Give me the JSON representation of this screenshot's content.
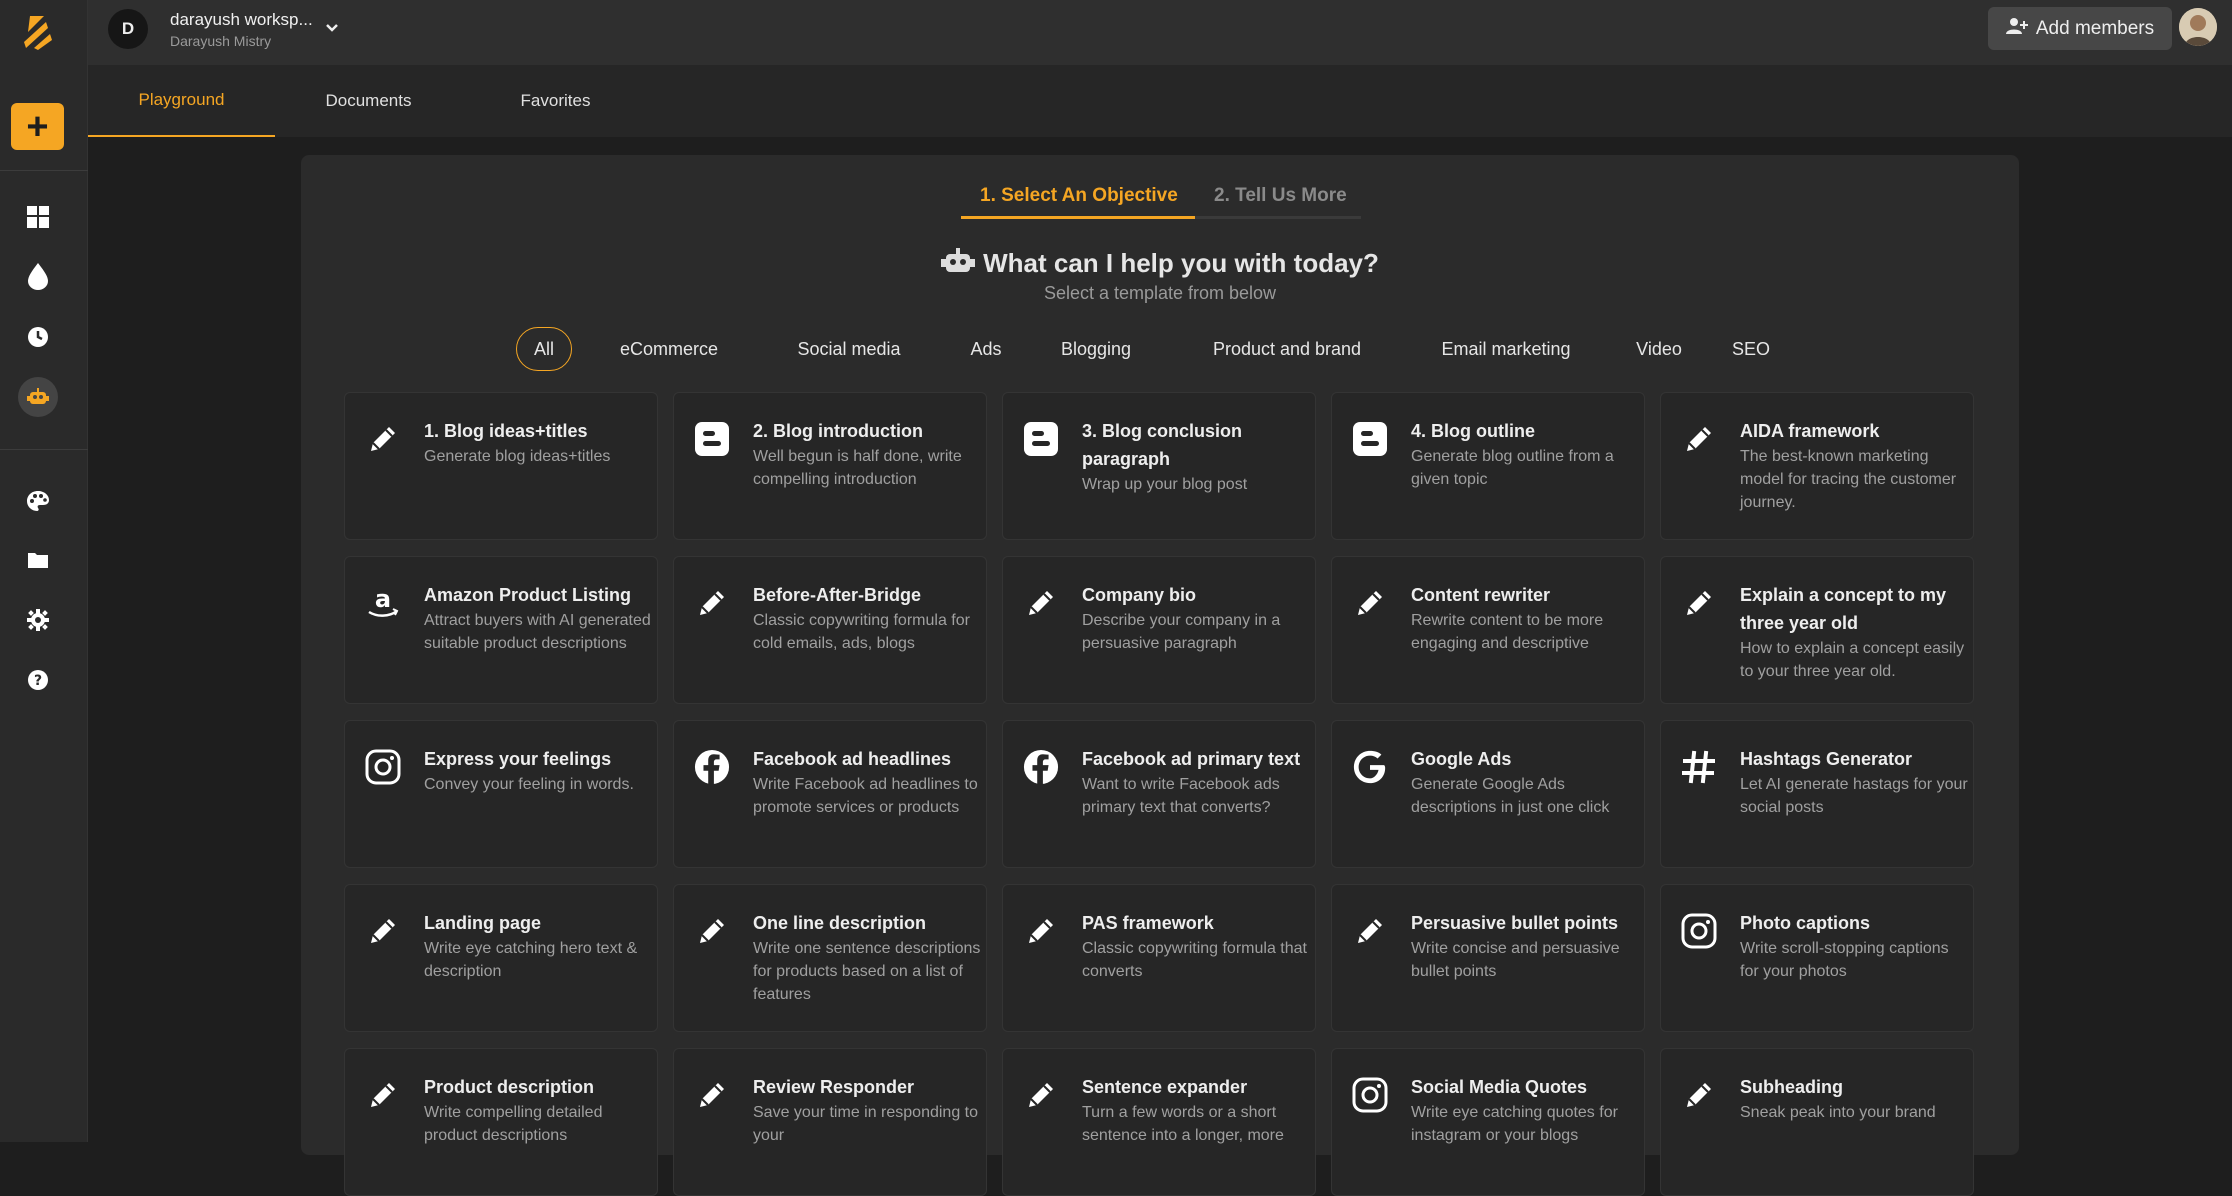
{
  "workspace": {
    "initial": "D",
    "name": "darayush worksp...",
    "owner": "Darayush Mistry"
  },
  "header": {
    "add_members_label": "Add members"
  },
  "tabs": [
    {
      "label": "Playground",
      "active": true
    },
    {
      "label": "Documents",
      "active": false
    },
    {
      "label": "Favorites",
      "active": false
    }
  ],
  "steps": {
    "step1": "1. Select An Objective",
    "step2": "2. Tell Us More"
  },
  "heading": {
    "title": "What can I help you with today?",
    "subtitle": "Select a template from below"
  },
  "filters": [
    "All",
    "eCommerce",
    "Social media",
    "Ads",
    "Blogging",
    "Product and brand",
    "Email marketing",
    "Video",
    "SEO"
  ],
  "sidebar_icons": [
    "dashboard-icon",
    "drop-icon",
    "clock-icon",
    "robot-icon",
    "palette-icon",
    "folder-icon",
    "gear-icon",
    "help-icon"
  ],
  "accent_color": "#f5a623",
  "cards": [
    {
      "icon": "pencil",
      "title": "1. Blog ideas+titles",
      "desc": "Generate blog ideas+titles"
    },
    {
      "icon": "blogger",
      "title": "2. Blog introduction",
      "desc": "Well begun is half done, write compelling introduction"
    },
    {
      "icon": "blogger",
      "title": "3. Blog conclusion paragraph",
      "desc": "Wrap up your blog post"
    },
    {
      "icon": "blogger",
      "title": "4. Blog outline",
      "desc": "Generate blog outline from a given topic"
    },
    {
      "icon": "pencil",
      "title": "AIDA framework",
      "desc": "The best-known marketing model for tracing the customer journey."
    },
    {
      "icon": "amazon",
      "title": "Amazon Product Listing",
      "desc": "Attract buyers with AI generated suitable product descriptions"
    },
    {
      "icon": "pencil",
      "title": "Before-After-Bridge",
      "desc": "Classic copywriting formula for cold emails, ads, blogs"
    },
    {
      "icon": "pencil",
      "title": "Company bio",
      "desc": "Describe your company in a persuasive paragraph"
    },
    {
      "icon": "pencil",
      "title": "Content rewriter",
      "desc": "Rewrite content to be more engaging and descriptive"
    },
    {
      "icon": "pencil",
      "title": "Explain a concept to my three year old",
      "desc": "How to explain a concept easily to your three year old."
    },
    {
      "icon": "instagram",
      "title": "Express your feelings",
      "desc": "Convey your feeling in words."
    },
    {
      "icon": "facebook",
      "title": "Facebook ad headlines",
      "desc": "Write Facebook ad headlines to promote services or products"
    },
    {
      "icon": "facebook",
      "title": "Facebook ad primary text",
      "desc": "Want to write Facebook ads primary text that converts?"
    },
    {
      "icon": "google",
      "title": "Google Ads",
      "desc": "Generate Google Ads descriptions in just one click"
    },
    {
      "icon": "hashtag",
      "title": "Hashtags Generator",
      "desc": "Let AI generate hastags for your social posts"
    },
    {
      "icon": "pencil",
      "title": "Landing page",
      "desc": "Write eye catching hero text & description"
    },
    {
      "icon": "pencil",
      "title": "One line description",
      "desc": "Write one sentence descriptions for products based on a list of features"
    },
    {
      "icon": "pencil",
      "title": "PAS framework",
      "desc": "Classic copywriting formula that converts"
    },
    {
      "icon": "pencil",
      "title": "Persuasive bullet points",
      "desc": "Write concise and persuasive bullet points"
    },
    {
      "icon": "instagram",
      "title": "Photo captions",
      "desc": "Write scroll-stopping captions for your photos"
    },
    {
      "icon": "pencil",
      "title": "Product description",
      "desc": "Write compelling detailed product descriptions"
    },
    {
      "icon": "pencil",
      "title": "Review Responder",
      "desc": "Save your time in responding to your"
    },
    {
      "icon": "pencil",
      "title": "Sentence expander",
      "desc": "Turn a few words or a short sentence into a longer, more"
    },
    {
      "icon": "instagram",
      "title": "Social Media Quotes",
      "desc": "Write eye catching quotes for instagram or your blogs"
    },
    {
      "icon": "pencil",
      "title": "Subheading",
      "desc": "Sneak peak into your brand"
    }
  ]
}
